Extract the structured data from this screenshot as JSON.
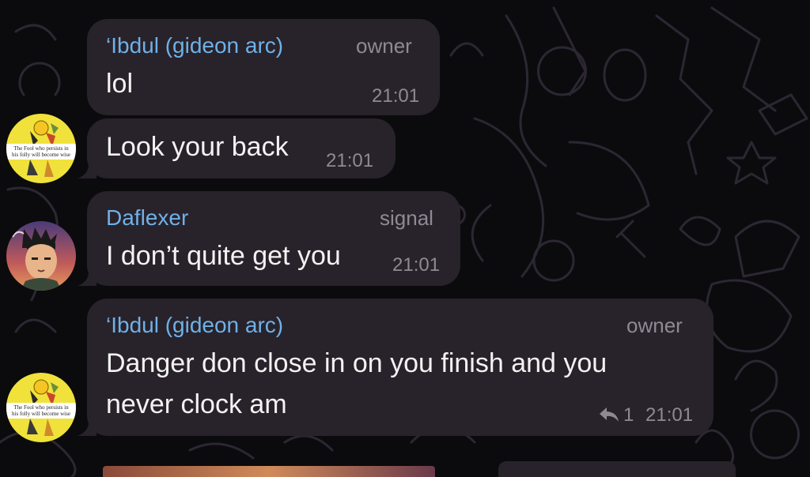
{
  "messages": [
    {
      "sender": "‘Ibdul (gideon arc)",
      "role": "owner",
      "text": "lol",
      "time": "21:01"
    },
    {
      "text": "Look your back",
      "time": "21:01",
      "avatar_caption": "The Fool who persists in his folly will become wise"
    },
    {
      "sender": "Daflexer",
      "role": "signal",
      "text": "I don’t quite get you",
      "time": "21:01"
    },
    {
      "sender": "‘Ibdul (gideon arc)",
      "role": "owner",
      "text_line1": "Danger don close in on you finish and you",
      "text_line2": "never clock am",
      "reply_count": "1",
      "time": "21:01",
      "avatar_caption": "The Fool who persists in his folly will become wise"
    }
  ],
  "colors": {
    "background": "#0b0b0d",
    "bubble": "#28222b",
    "sender_name": "#6fb1e6",
    "meta": "#8e8a93",
    "text": "#f2f2f2",
    "doodle": "#2c2733"
  },
  "icons": [
    "reply-arrow-icon",
    "tarot-avatar",
    "anime-avatar"
  ]
}
